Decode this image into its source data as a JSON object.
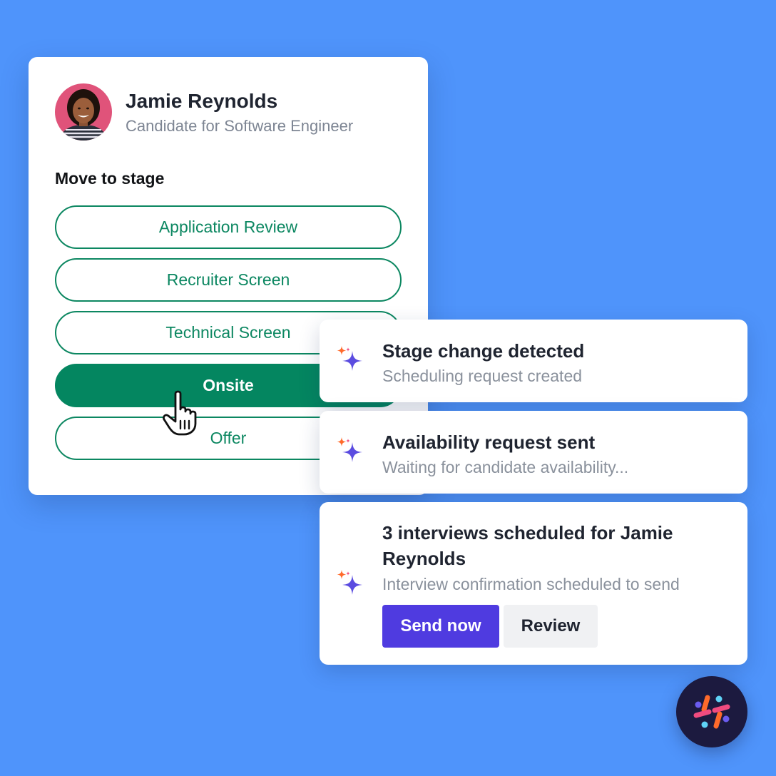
{
  "candidate": {
    "name": "Jamie Reynolds",
    "role": "Candidate for Software Engineer",
    "avatar_icon": "candidate-photo"
  },
  "stage_picker": {
    "heading": "Move to stage",
    "stages": [
      {
        "label": "Application Review",
        "active": false
      },
      {
        "label": "Recruiter Screen",
        "active": false
      },
      {
        "label": "Technical Screen",
        "active": false
      },
      {
        "label": "Onsite",
        "active": true
      },
      {
        "label": "Offer",
        "active": false
      }
    ],
    "active_color": "#048660"
  },
  "notifications": [
    {
      "icon": "sparkle-icon",
      "title": "Stage change detected",
      "subtitle": "Scheduling request created"
    },
    {
      "icon": "sparkle-icon",
      "title": "Availability request sent",
      "subtitle": "Waiting for candidate availability..."
    },
    {
      "icon": "sparkle-icon",
      "title": "3 interviews scheduled for Jamie Reynolds",
      "subtitle": "Interview confirmation scheduled to send",
      "actions": {
        "primary": "Send now",
        "secondary": "Review"
      }
    }
  ],
  "colors": {
    "background": "#4F94FB",
    "primary_button": "#4F3BE0",
    "sparkle_purple": "#5B4CE0",
    "sparkle_orange": "#FF6A2B",
    "badge_bg": "#1C1A3F"
  },
  "brand": {
    "icon": "brand-logo-icon"
  }
}
